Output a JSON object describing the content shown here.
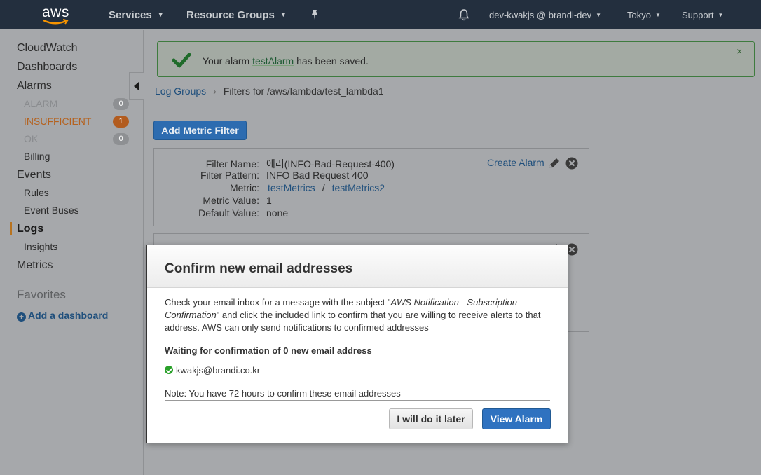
{
  "topnav": {
    "logo_text": "aws",
    "services": "Services",
    "resource_groups": "Resource Groups",
    "account": "dev-kwakjs @ brandi-dev",
    "region": "Tokyo",
    "support": "Support"
  },
  "sidebar": {
    "cloudwatch": "CloudWatch",
    "dashboards": "Dashboards",
    "alarms": "Alarms",
    "alarm_states": [
      {
        "label": "ALARM",
        "count": "0"
      },
      {
        "label": "INSUFFICIENT",
        "count": "1"
      },
      {
        "label": "OK",
        "count": "0"
      }
    ],
    "billing": "Billing",
    "events": "Events",
    "rules": "Rules",
    "event_buses": "Event Buses",
    "logs": "Logs",
    "insights": "Insights",
    "metrics": "Metrics",
    "favorites": "Favorites",
    "add_dashboard": "Add a dashboard"
  },
  "alert": {
    "prefix": "Your alarm",
    "alarm_name": "testAlarm",
    "suffix": "has been saved.",
    "close": "×"
  },
  "breadcrumb": {
    "root": "Log Groups",
    "current": "Filters for /aws/lambda/test_lambda1"
  },
  "add_metric_filter": "Add Metric Filter",
  "filter_card": {
    "labels": {
      "name": "Filter Name:",
      "pattern": "Filter Pattern:",
      "metric": "Metric:",
      "value": "Metric Value:",
      "default": "Default Value:"
    },
    "name": "에러(INFO-Bad-Request-400)",
    "pattern": "INFO Bad Request 400",
    "metric_namespace": "testMetrics",
    "metric_separator": "/",
    "metric_name": "testMetrics2",
    "value": "1",
    "default": "none",
    "create_alarm": "Create Alarm"
  },
  "modal": {
    "title": "Confirm new email addresses",
    "body_1": "Check your email inbox for a message with the subject \"",
    "body_subject": "AWS Notification - Subscription Confirmation",
    "body_2": "\" and click the included link to confirm that you are willing to receive alerts to that address. AWS can only send notifications to confirmed addresses",
    "waiting": "Waiting for confirmation of 0 new email address",
    "email": "kwakjs@brandi.co.kr",
    "note": "Note: You have 72 hours to confirm these email addresses",
    "later": "I will do it later",
    "view": "View Alarm"
  },
  "colors": {
    "nav_bg": "#232f3e",
    "primary": "#2d6cb0",
    "warning": "#b25c1f",
    "success": "#2aa02a"
  }
}
